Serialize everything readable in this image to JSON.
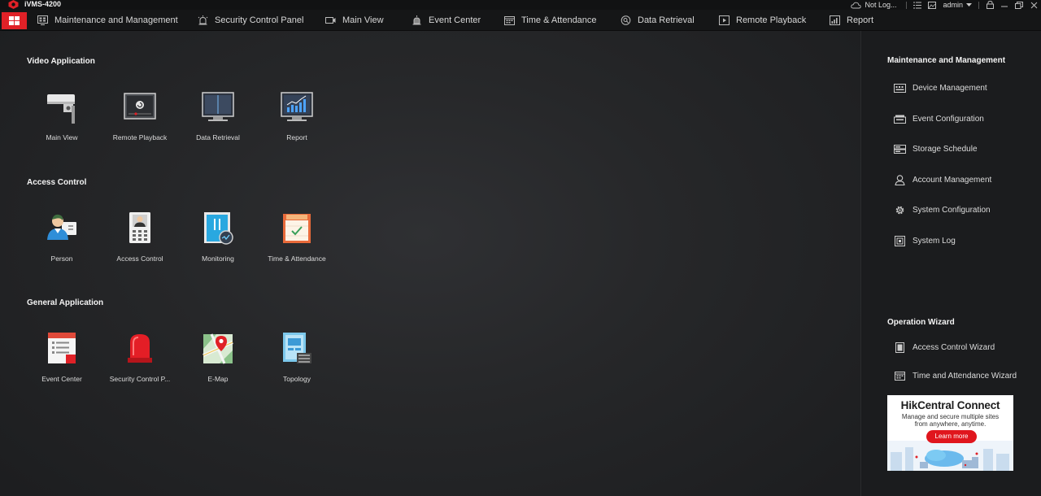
{
  "titlebar": {
    "app_title": "iVMS-4200",
    "login_status": "Not Log...",
    "user": "admin"
  },
  "nav": {
    "items": [
      {
        "label": "Maintenance and Management",
        "icon": "monitor-grid-icon"
      },
      {
        "label": "Security Control Panel",
        "icon": "alarm-light-icon"
      },
      {
        "label": "Main View",
        "icon": "camera-icon"
      },
      {
        "label": "Event Center",
        "icon": "siren-icon"
      },
      {
        "label": "Time & Attendance",
        "icon": "calendar-icon"
      },
      {
        "label": "Data Retrieval",
        "icon": "search-icon"
      },
      {
        "label": "Remote Playback",
        "icon": "playback-icon"
      },
      {
        "label": "Report",
        "icon": "report-icon"
      }
    ]
  },
  "sections": [
    {
      "title": "Video Application",
      "apps": [
        {
          "label": "Main View",
          "icon": "camera-icon"
        },
        {
          "label": "Remote Playback",
          "icon": "playback-monitor-icon"
        },
        {
          "label": "Data Retrieval",
          "icon": "data-monitor-icon"
        },
        {
          "label": "Report",
          "icon": "chart-monitor-icon"
        }
      ]
    },
    {
      "title": "Access Control",
      "apps": [
        {
          "label": "Person",
          "icon": "person-card-icon"
        },
        {
          "label": "Access Control",
          "icon": "door-terminal-icon"
        },
        {
          "label": "Monitoring",
          "icon": "door-monitoring-icon"
        },
        {
          "label": "Time & Attendance",
          "icon": "calendar-check-icon"
        }
      ]
    },
    {
      "title": "General Application",
      "apps": [
        {
          "label": "Event Center",
          "icon": "event-list-icon"
        },
        {
          "label": "Security Control P...",
          "icon": "alarm-light-icon"
        },
        {
          "label": "E-Map",
          "icon": "map-pin-icon"
        },
        {
          "label": "Topology",
          "icon": "topology-icon"
        }
      ]
    }
  ],
  "side": {
    "mm_title": "Maintenance and Management",
    "mm_items": [
      {
        "label": "Device Management",
        "icon": "device-icon"
      },
      {
        "label": "Event Configuration",
        "icon": "event-config-icon"
      },
      {
        "label": "Storage Schedule",
        "icon": "storage-icon"
      },
      {
        "label": "Account Management",
        "icon": "user-icon"
      },
      {
        "label": "System Configuration",
        "icon": "gear-icon"
      },
      {
        "label": "System Log",
        "icon": "log-icon"
      }
    ],
    "wizard_title": "Operation Wizard",
    "wizard_items": [
      {
        "label": "Access Control Wizard",
        "icon": "door-icon"
      },
      {
        "label": "Time and Attendance Wizard",
        "icon": "calendar-icon"
      }
    ],
    "ad": {
      "title": "HikCentral Connect",
      "subtitle_line1": "Manage and secure multiple sites",
      "subtitle_line2": "from anywhere, anytime.",
      "button": "Learn more"
    }
  },
  "colors": {
    "accent": "#e02127",
    "background": "#1e1f21",
    "navbar": "#151617"
  }
}
